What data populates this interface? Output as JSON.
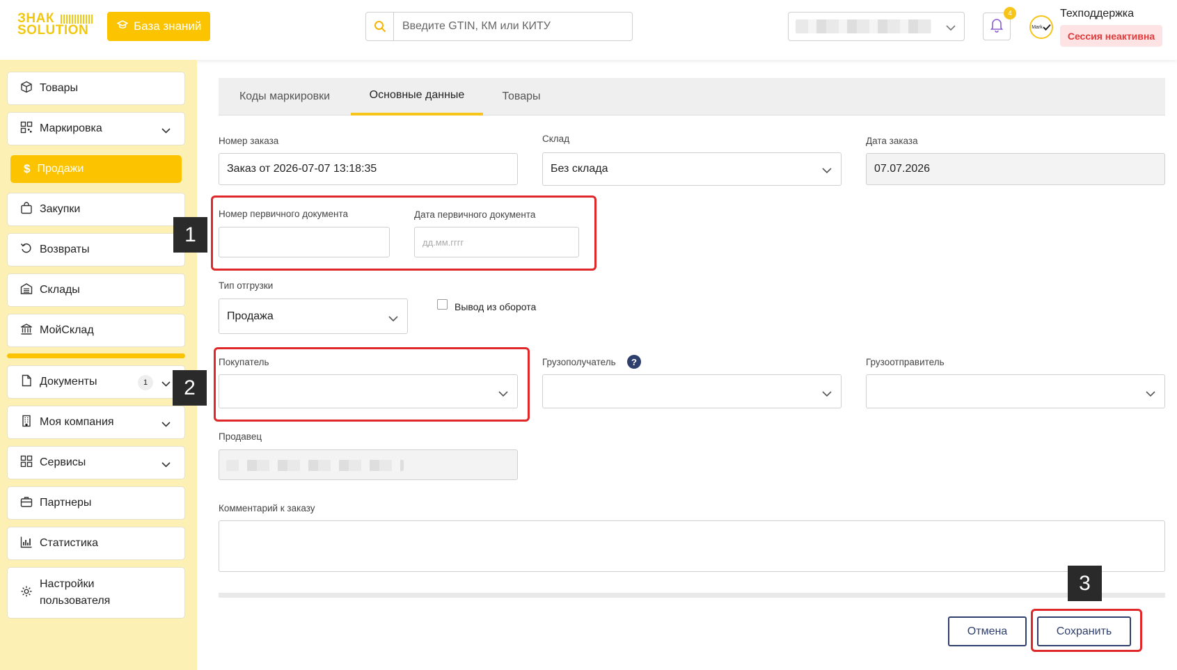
{
  "header": {
    "logo_line1": "ЗНАК",
    "logo_line2": "SOLUTION",
    "kb_button": "База знаний",
    "search_placeholder": "Введите GTIN, КМ или КИТУ",
    "notification_count": "4",
    "avatar_text": "Mark",
    "user_name": "Техподдержка",
    "session_status": "Сессия неактивна"
  },
  "sidebar": {
    "items": [
      {
        "label": "Товары",
        "icon": "box-icon"
      },
      {
        "label": "Маркировка",
        "icon": "qr-icon"
      },
      {
        "label": "Продажи",
        "icon": "dollar-icon"
      },
      {
        "label": "Закупки",
        "icon": "bag-icon"
      },
      {
        "label": "Возвраты",
        "icon": "return-icon"
      },
      {
        "label": "Склады",
        "icon": "warehouse-icon"
      },
      {
        "label": "МойСклад",
        "icon": "bank-icon"
      },
      {
        "label": "Документы",
        "icon": "document-icon",
        "count": "1"
      },
      {
        "label": "Моя компания",
        "icon": "building-icon"
      },
      {
        "label": "Сервисы",
        "icon": "grid-icon"
      },
      {
        "label": "Партнеры",
        "icon": "briefcase-icon"
      },
      {
        "label": "Статистика",
        "icon": "chart-icon"
      },
      {
        "label_line1": "Настройки",
        "label_line2": "пользователя",
        "icon": "gear-icon"
      }
    ]
  },
  "tabs": [
    {
      "label": "Коды маркировки"
    },
    {
      "label": "Основные данные"
    },
    {
      "label": "Товары"
    }
  ],
  "form": {
    "order_number_label": "Номер заказа",
    "order_number_value": "Заказ от 2026-07-07 13:18:35",
    "warehouse_label": "Склад",
    "warehouse_value": "Без склада",
    "order_date_label": "Дата заказа",
    "order_date_value": "07.07.2026",
    "primary_doc_number_label": "Номер первичного документа",
    "primary_doc_date_label": "Дата первичного документа",
    "primary_doc_date_placeholder": "дд.мм.гггг",
    "shipment_type_label": "Тип отгрузки",
    "shipment_type_value": "Продажа",
    "withdraw_label": "Вывод из оборота",
    "buyer_label": "Покупатель",
    "consignee_label": "Грузополучатель",
    "shipper_label": "Грузоотправитель",
    "seller_label": "Продавец",
    "comment_label": "Комментарий к заказу"
  },
  "actions": {
    "cancel": "Отмена",
    "save": "Сохранить"
  },
  "annotations": {
    "marker_1": "1",
    "marker_2": "2",
    "marker_3": "3"
  },
  "colors": {
    "accent": "#fcc400",
    "sidebar_bg": "#fdf0b5",
    "annotation_red": "#e0272a",
    "button_navy": "#2e3f6e",
    "session_red": "#e23a3a"
  }
}
